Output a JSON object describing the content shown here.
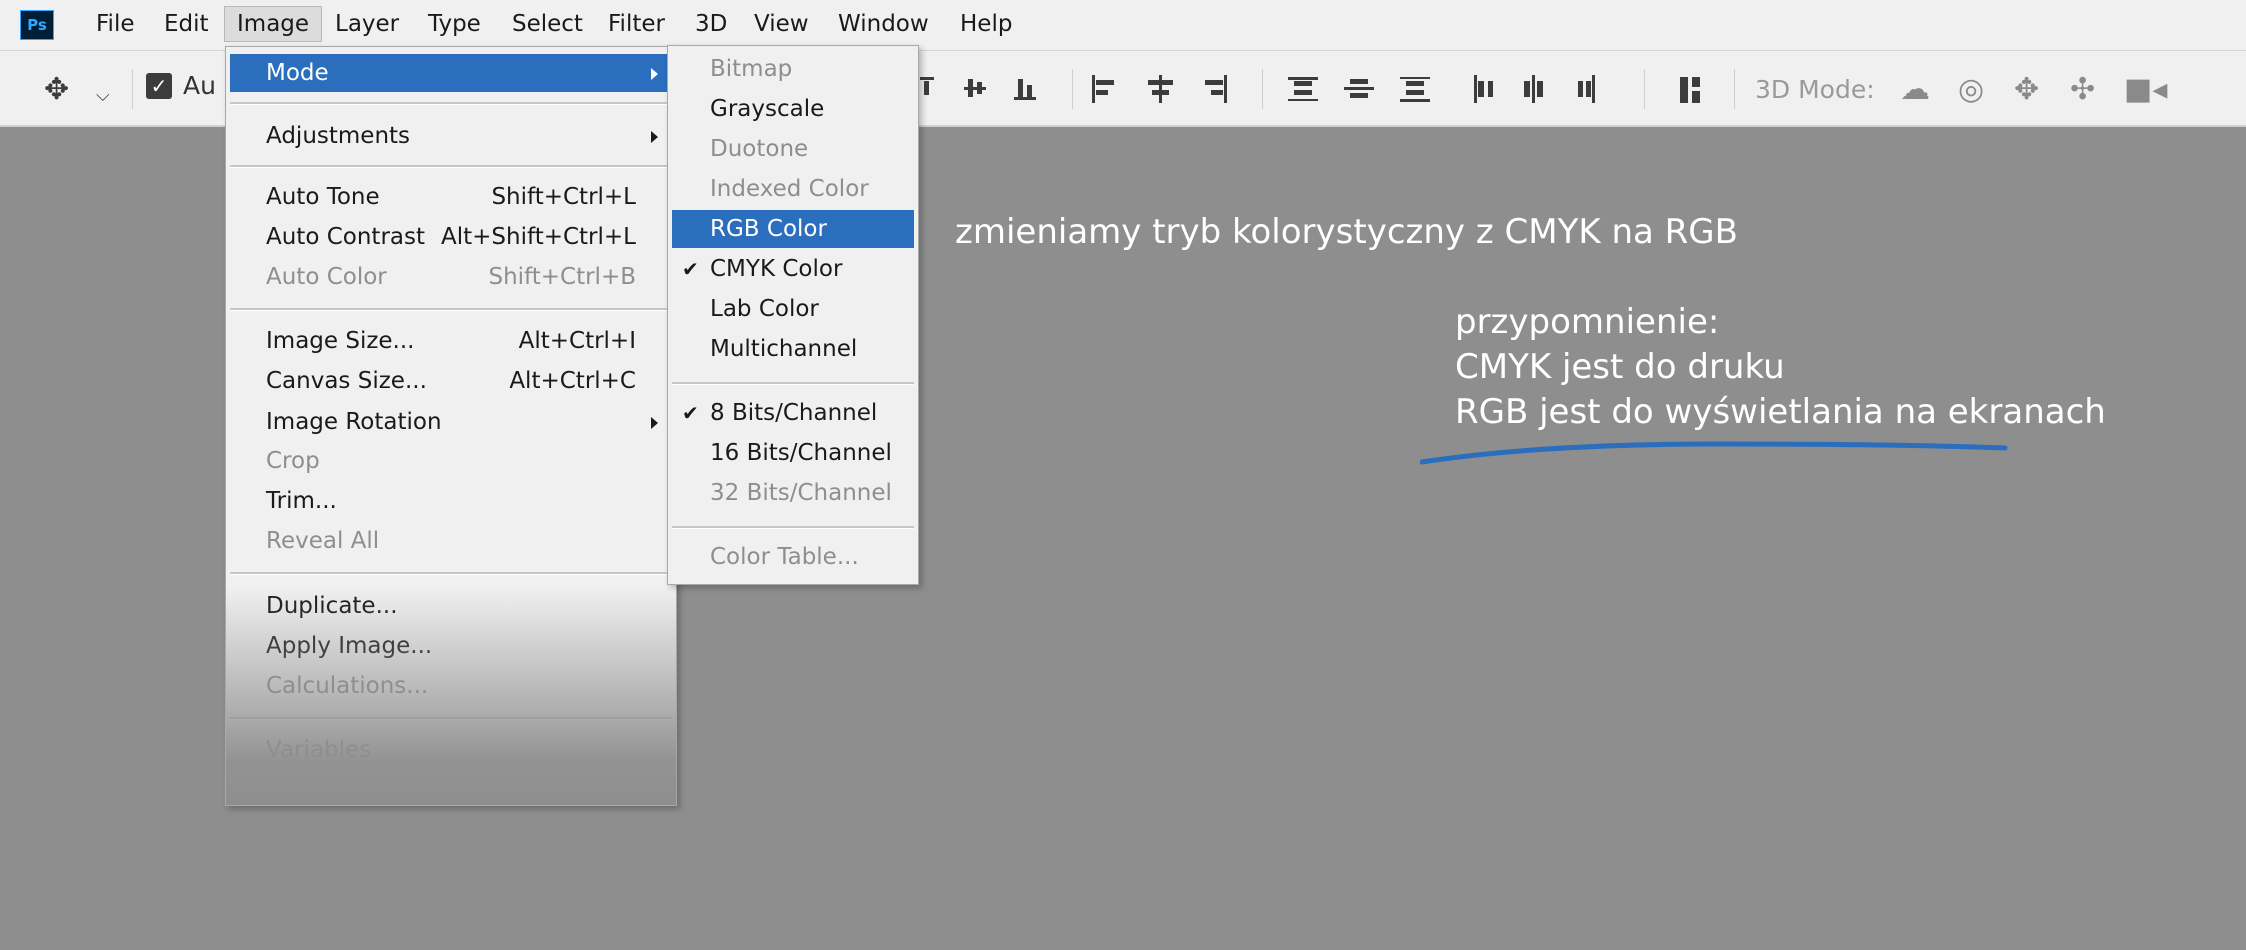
{
  "app": {
    "logo_text": "Ps"
  },
  "menubar": {
    "items": [
      "File",
      "Edit",
      "Image",
      "Layer",
      "Type",
      "Select",
      "Filter",
      "3D",
      "View",
      "Window",
      "Help"
    ],
    "open_item": "Image"
  },
  "options_bar": {
    "auto_select_label": "Au",
    "auto_select_checked": true,
    "mode3d_label": "3D Mode:",
    "icons": [
      "move-tool-icon",
      "align-top-icon",
      "align-vertical-center-icon",
      "align-bottom-icon",
      "align-left-icon",
      "align-horizontal-center-icon",
      "align-right-icon",
      "distribute-top-icon",
      "distribute-vertical-center-icon",
      "distribute-bottom-icon",
      "distribute-left-icon",
      "distribute-horizontal-center-icon",
      "distribute-right-icon",
      "auto-align-layers-icon",
      "orbit-3d-icon",
      "roll-3d-icon",
      "drag-3d-icon",
      "slide-3d-icon",
      "scale-3d-icon"
    ]
  },
  "image_menu": {
    "mode": "Mode",
    "adjustments": "Adjustments",
    "auto_tone": {
      "label": "Auto Tone",
      "shortcut": "Shift+Ctrl+L"
    },
    "auto_contrast": {
      "label": "Auto Contrast",
      "shortcut": "Alt+Shift+Ctrl+L"
    },
    "auto_color": {
      "label": "Auto Color",
      "shortcut": "Shift+Ctrl+B"
    },
    "image_size": {
      "label": "Image Size...",
      "shortcut": "Alt+Ctrl+I"
    },
    "canvas_size": {
      "label": "Canvas Size...",
      "shortcut": "Alt+Ctrl+C"
    },
    "image_rotation": "Image Rotation",
    "crop": "Crop",
    "trim": "Trim...",
    "reveal_all": "Reveal All",
    "duplicate": "Duplicate...",
    "apply_image": "Apply Image...",
    "calculations": "Calculations...",
    "variables": "Variables"
  },
  "mode_submenu": {
    "bitmap": "Bitmap",
    "grayscale": "Grayscale",
    "duotone": "Duotone",
    "indexed_color": "Indexed Color",
    "rgb_color": "RGB Color",
    "cmyk_color": "CMYK Color",
    "lab_color": "Lab Color",
    "multichannel": "Multichannel",
    "bits8": "8 Bits/Channel",
    "bits16": "16 Bits/Channel",
    "bits32": "32 Bits/Channel",
    "color_table": "Color Table...",
    "checked_items": [
      "CMYK Color",
      "8 Bits/Channel"
    ],
    "highlighted_item": "RGB Color"
  },
  "annotations": {
    "main": "zmieniamy tryb kolorystyczny z CMYK na RGB",
    "reminder_title": "przypomnienie:",
    "reminder_line1": "CMYK jest do druku",
    "reminder_line2": "RGB jest do wyświetlania na ekranach"
  },
  "colors": {
    "highlight": "#2b6ebd",
    "canvas": "#8e8e8e",
    "underline_stroke": "#2b6ebd"
  }
}
